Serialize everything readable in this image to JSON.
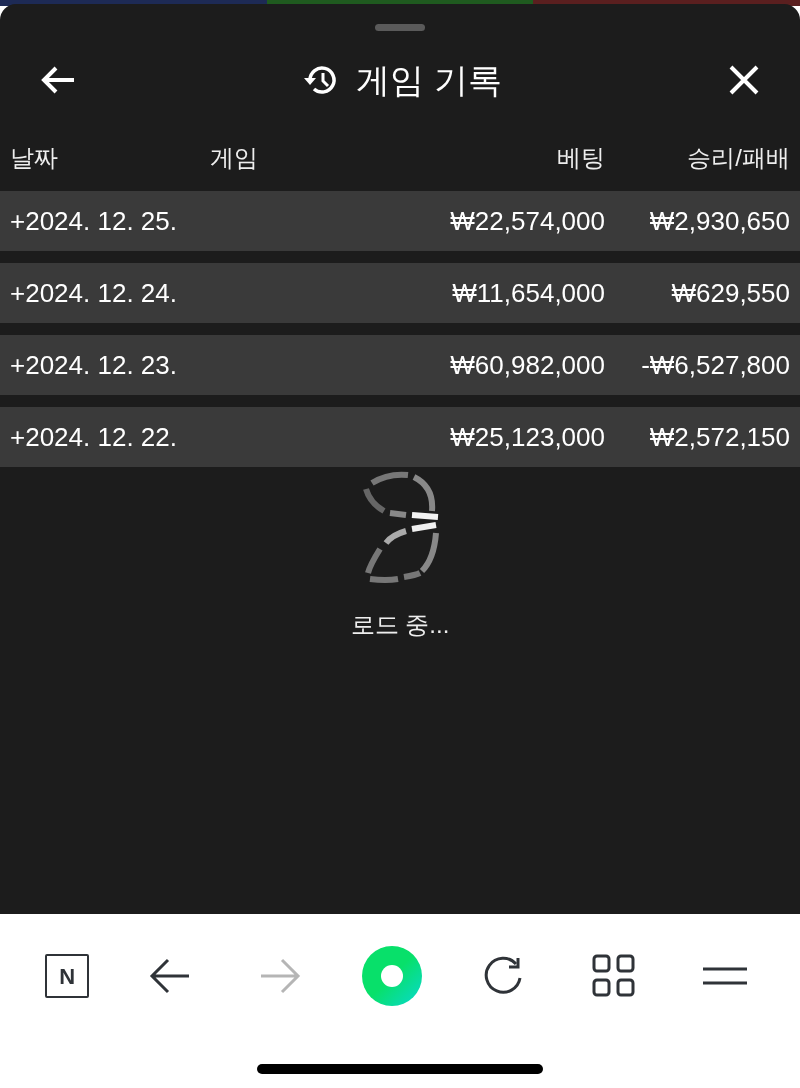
{
  "header": {
    "title": "게임 기록"
  },
  "table": {
    "columns": [
      "날짜",
      "게임",
      "베팅",
      "승리/패배"
    ],
    "rows": [
      {
        "date": "+2024. 12. 25.",
        "bet": "₩22,574,000",
        "result": "₩2,930,650"
      },
      {
        "date": "+2024. 12. 24.",
        "bet": "₩11,654,000",
        "result": "₩629,550"
      },
      {
        "date": "+2024. 12. 23.",
        "bet": "₩60,982,000",
        "result": "-₩6,527,800"
      },
      {
        "date": "+2024. 12. 22.",
        "bet": "₩25,123,000",
        "result": "₩2,572,150"
      }
    ]
  },
  "loading": {
    "text": "로드 중..."
  },
  "browser_bar": {
    "logo_letter": "N",
    "forward_disabled": true
  }
}
